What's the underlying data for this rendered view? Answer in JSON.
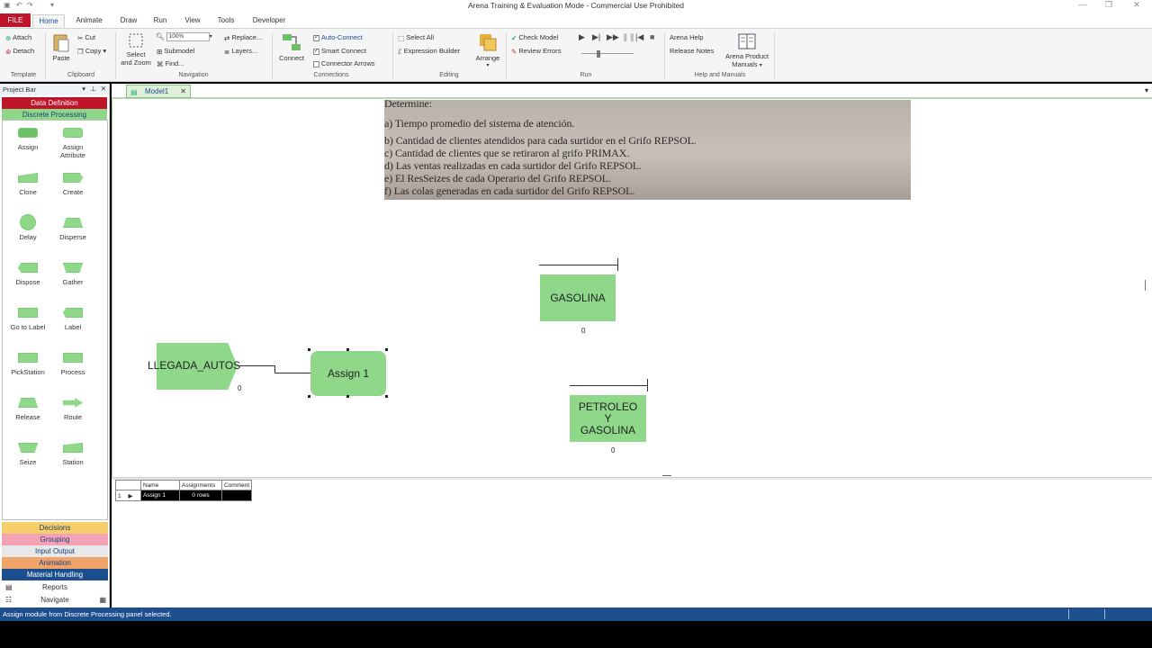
{
  "window": {
    "title": "Arena Training & Evaluation Mode - Commercial Use Prohibited"
  },
  "ribbon_tabs": [
    "FILE",
    "Home",
    "Animate",
    "Draw",
    "Run",
    "View",
    "Tools",
    "Developer"
  ],
  "ribbon": {
    "template": {
      "attach": "Attach",
      "detach": "Detach",
      "label": "Template"
    },
    "clipboard": {
      "paste": "Paste",
      "cut": "Cut",
      "copy": "Copy",
      "label": "Clipboard"
    },
    "navigation": {
      "select_zoom_1": "Select",
      "select_zoom_2": "and Zoom",
      "zoom_value": "100%",
      "submodel": "Submodel",
      "find": "Find...",
      "replace": "Replace...",
      "layers": "Layers...",
      "label": "Navigation"
    },
    "connections": {
      "connect": "Connect",
      "auto_connect": "Auto-Connect",
      "smart_connect": "Smart Connect",
      "connector_arrows": "Connector Arrows",
      "label": "Connections"
    },
    "editing": {
      "select_all": "Select All",
      "expression_builder": "Expression Builder",
      "arrange": "Arrange",
      "label": "Editing"
    },
    "run": {
      "check_model": "Check Model",
      "review_errors": "Review Errors",
      "label": "Run"
    },
    "help": {
      "arena_help": "Arena Help",
      "release_notes": "Release Notes",
      "product_manuals_1": "Arena Product",
      "product_manuals_2": "Manuals",
      "label": "Help and Manuals"
    }
  },
  "project_bar": {
    "title": "Project Bar",
    "panels_top": [
      "Data Definition",
      "Discrete Processing"
    ],
    "modules": [
      [
        "Assign",
        ""
      ],
      [
        "Assign",
        "Attribute"
      ],
      [
        "Clone",
        ""
      ],
      [
        "Create",
        ""
      ],
      [
        "Delay",
        ""
      ],
      [
        "Disperse",
        ""
      ],
      [
        "Dispose",
        ""
      ],
      [
        "Gather",
        ""
      ],
      [
        "Go to Label",
        ""
      ],
      [
        "Label",
        ""
      ],
      [
        "PickStation",
        ""
      ],
      [
        "Process",
        ""
      ],
      [
        "Release",
        ""
      ],
      [
        "Route",
        ""
      ],
      [
        "Seize",
        ""
      ],
      [
        "Station",
        ""
      ]
    ],
    "panels_bottom": [
      "Decisions",
      "Grouping",
      "Input Output",
      "Animation",
      "Material Handling",
      "Reports",
      "Navigate"
    ],
    "panel_colors": {
      "data_definition": "#c0142b",
      "discrete_processing": "#8fd88a",
      "decisions": "#f6cf6a",
      "grouping": "#f4a3b6",
      "input_output": "#e8e8e8",
      "animation": "#f0a46a",
      "material_handling": "#1b4e8c"
    }
  },
  "model": {
    "tab_label": "Model1",
    "image_text": [
      "Determine:",
      "a) Tiempo promedio del sistema de atención.",
      "b) Cantidad de clientes atendidos para cada surtidor en el Grifo REPSOL.",
      "c) Cantidad de clientes que se retiraron al grifo PRIMAX.",
      "d) Las ventas realizadas en cada surtidor del Grifo REPSOL.",
      "e) El ResSeizes de cada Operario del Grifo REPSOL.",
      "f) Las colas generadas en cada surtidor del Grifo REPSOL."
    ],
    "blocks": {
      "llegada": "LLEGADA_AUTOS",
      "assign": "Assign 1",
      "gasolina": "GASOLINA",
      "petroleo_1": "PETROLEO",
      "petroleo_2": "Y",
      "petroleo_3": "GASOLINA"
    },
    "counters": {
      "llegada": "0",
      "gasolina": "0",
      "petroleo": "0"
    }
  },
  "spreadsheet": {
    "headers": [
      "Name",
      "Assignments",
      "Comment"
    ],
    "rows": [
      {
        "num": "1",
        "name": "Assign 1",
        "assignments": "0 rows",
        "comment": ""
      }
    ]
  },
  "status": {
    "message": "Assign module from Discrete Processing panel selected."
  }
}
